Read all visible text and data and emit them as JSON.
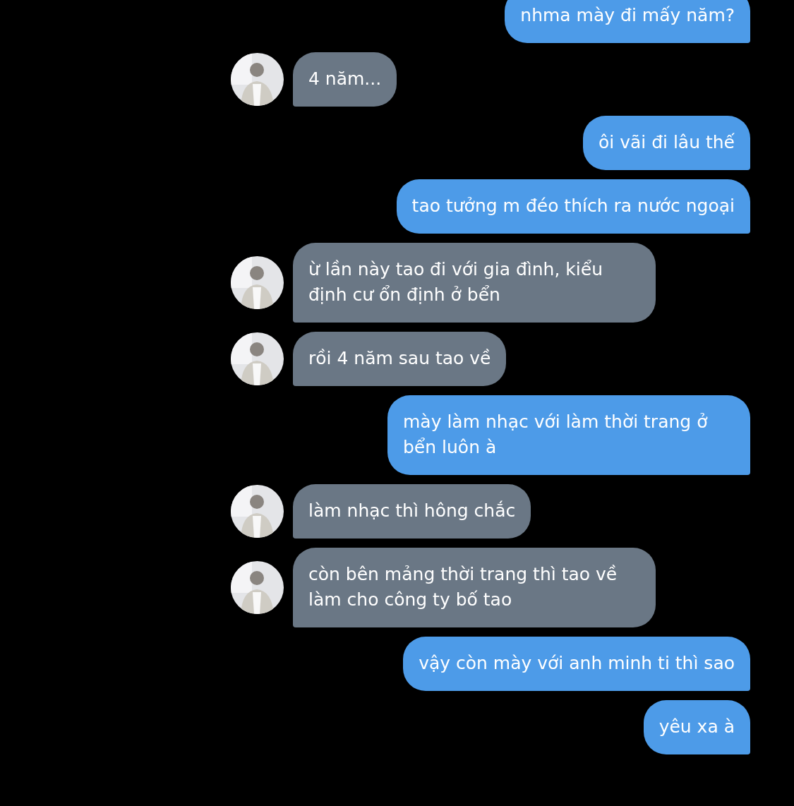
{
  "messages": [
    {
      "kind": "sent",
      "text": "nhma mày đi mấy năm?"
    },
    {
      "kind": "received",
      "text": "4 năm..."
    },
    {
      "kind": "sent",
      "text": "ôi vãi đi lâu thế"
    },
    {
      "kind": "sent",
      "text": "tao tưởng m đéo thích ra nước ngoại"
    },
    {
      "kind": "received",
      "text": "ừ lần này tao đi với gia đình, kiểu định cư ổn định ở bển"
    },
    {
      "kind": "received",
      "text": "rồi 4 năm sau tao về"
    },
    {
      "kind": "sent",
      "text": "mày làm nhạc với làm thời trang ở bển luôn à"
    },
    {
      "kind": "received",
      "text": "làm nhạc thì hông chắc"
    },
    {
      "kind": "received",
      "text": "còn bên mảng thời trang thì tao về làm cho công ty bố tao"
    },
    {
      "kind": "sent",
      "text": "vậy còn mày với anh minh ti thì sao"
    },
    {
      "kind": "sent",
      "text": "yêu xa à"
    }
  ]
}
